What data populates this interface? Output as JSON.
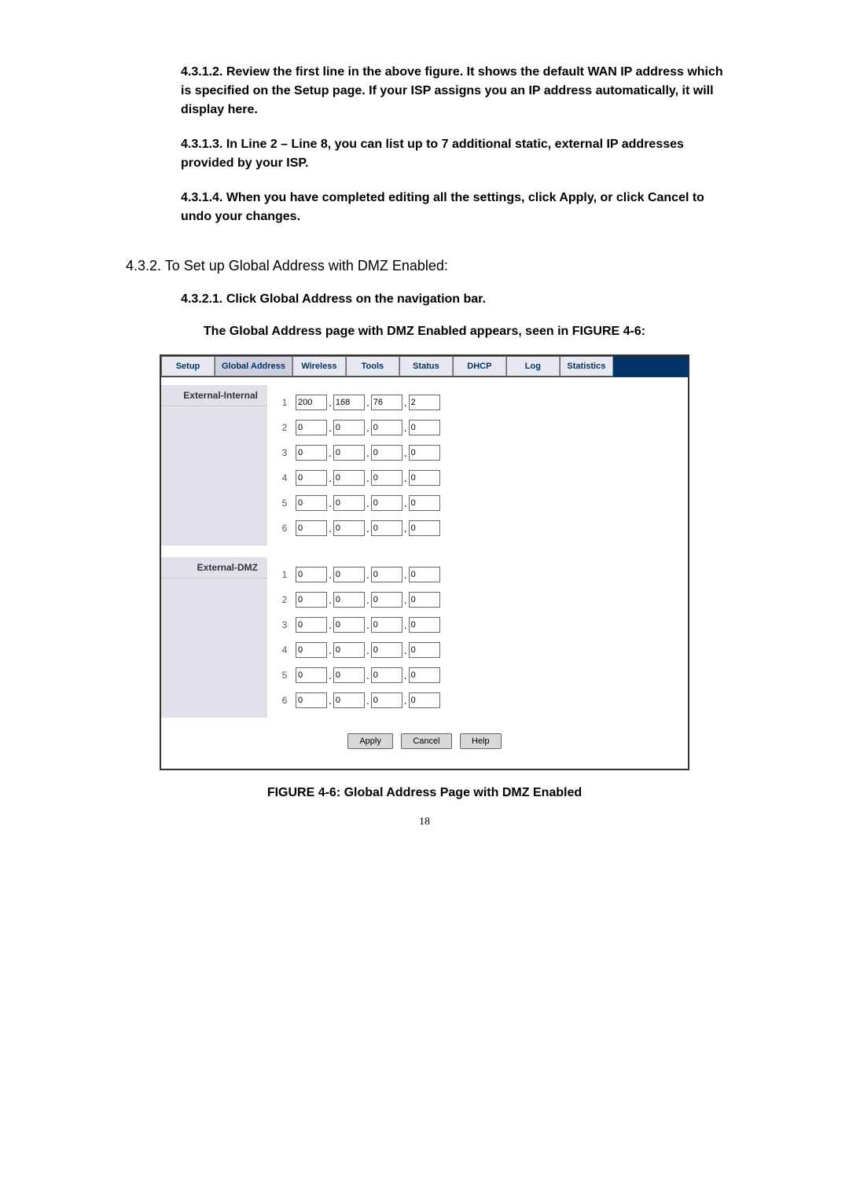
{
  "paragraphs": {
    "p1": "4.3.1.2. Review the first line in the above figure. It shows the default WAN IP address which is specified on the Setup page. If your ISP assigns you an IP address automatically, it will display here.",
    "p2": "4.3.1.3. In Line 2 – Line 8, you can list up to 7 additional static, external IP addresses provided by your ISP.",
    "p3": "4.3.1.4. When you have completed editing all the settings, click Apply, or click Cancel to undo your changes.",
    "heading": "4.3.2. To Set up Global Address with DMZ Enabled:",
    "p4": "4.3.2.1. Click Global Address on the navigation bar.",
    "p5": "The Global Address page with DMZ Enabled appears, seen in FIGURE 4-6:"
  },
  "tabs": [
    "Setup",
    "Global Address",
    "Wireless",
    "Tools",
    "Status",
    "DHCP",
    "Log",
    "Statistics"
  ],
  "sections": {
    "section1": "External-Internal",
    "section2": "External-DMZ"
  },
  "ip_internal": [
    {
      "num": "1",
      "a": "200",
      "b": "168",
      "c": "76",
      "d": "2"
    },
    {
      "num": "2",
      "a": "0",
      "b": "0",
      "c": "0",
      "d": "0"
    },
    {
      "num": "3",
      "a": "0",
      "b": "0",
      "c": "0",
      "d": "0"
    },
    {
      "num": "4",
      "a": "0",
      "b": "0",
      "c": "0",
      "d": "0"
    },
    {
      "num": "5",
      "a": "0",
      "b": "0",
      "c": "0",
      "d": "0"
    },
    {
      "num": "6",
      "a": "0",
      "b": "0",
      "c": "0",
      "d": "0"
    }
  ],
  "ip_dmz": [
    {
      "num": "1",
      "a": "0",
      "b": "0",
      "c": "0",
      "d": "0"
    },
    {
      "num": "2",
      "a": "0",
      "b": "0",
      "c": "0",
      "d": "0"
    },
    {
      "num": "3",
      "a": "0",
      "b": "0",
      "c": "0",
      "d": "0"
    },
    {
      "num": "4",
      "a": "0",
      "b": "0",
      "c": "0",
      "d": "0"
    },
    {
      "num": "5",
      "a": "0",
      "b": "0",
      "c": "0",
      "d": "0"
    },
    {
      "num": "6",
      "a": "0",
      "b": "0",
      "c": "0",
      "d": "0"
    }
  ],
  "buttons": {
    "apply": "Apply",
    "cancel": "Cancel",
    "help": "Help"
  },
  "figure_caption": "FIGURE 4-6: Global Address Page with DMZ Enabled",
  "page_number": "18"
}
